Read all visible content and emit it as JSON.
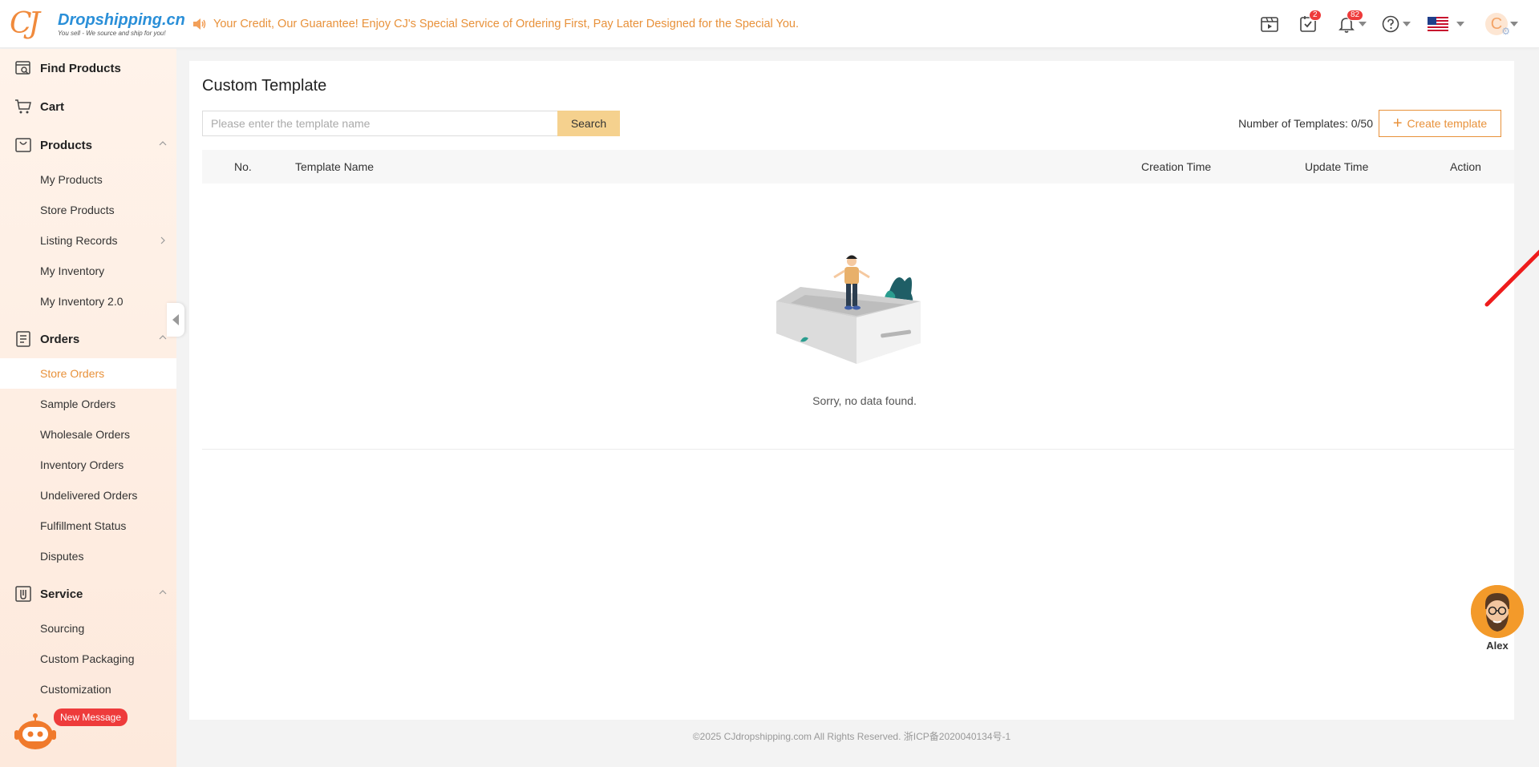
{
  "header": {
    "logo_text": "Dropshipping.cn",
    "logo_slogan": "You sell - We source and ship for you!",
    "logo_mark": "CJ",
    "announcement": "Your Credit, Our Guarantee! Enjoy CJ's Special Service of Ordering First, Pay Later Designed for the Special You.",
    "tasks_badge": "2",
    "notifications_badge": "82",
    "avatar_initial": "C",
    "brand_color": "#e8913a"
  },
  "sidebar": {
    "groups": [
      {
        "label": "Find Products",
        "icon": "find-products-icon"
      },
      {
        "label": "Cart",
        "icon": "cart-icon"
      },
      {
        "label": "Products",
        "icon": "products-icon",
        "items": [
          "My Products",
          "Store Products",
          "Listing Records",
          "My Inventory",
          "My Inventory 2.0"
        ]
      },
      {
        "label": "Orders",
        "icon": "orders-icon",
        "items": [
          "Store Orders",
          "Sample Orders",
          "Wholesale Orders",
          "Inventory Orders",
          "Undelivered Orders",
          "Fulfillment Status",
          "Disputes"
        ]
      },
      {
        "label": "Service",
        "icon": "service-icon",
        "items": [
          "Sourcing",
          "Custom Packaging",
          "Customization"
        ]
      }
    ],
    "active_item": "Store Orders",
    "new_message": "New Message"
  },
  "main": {
    "title": "Custom Template",
    "search": {
      "placeholder": "Please enter the template name",
      "value": "",
      "button": "Search"
    },
    "count_label": "Number of Templates: 0/50",
    "create_button": "Create template",
    "columns": [
      "No.",
      "Template Name",
      "Creation Time",
      "Update Time",
      "Action"
    ],
    "empty_text": "Sorry, no data found."
  },
  "assistant": {
    "name": "Alex"
  },
  "footer": {
    "copyright": "©2025 CJdropshipping.com All Rights Reserved. 浙ICP备2020040134号-1"
  }
}
